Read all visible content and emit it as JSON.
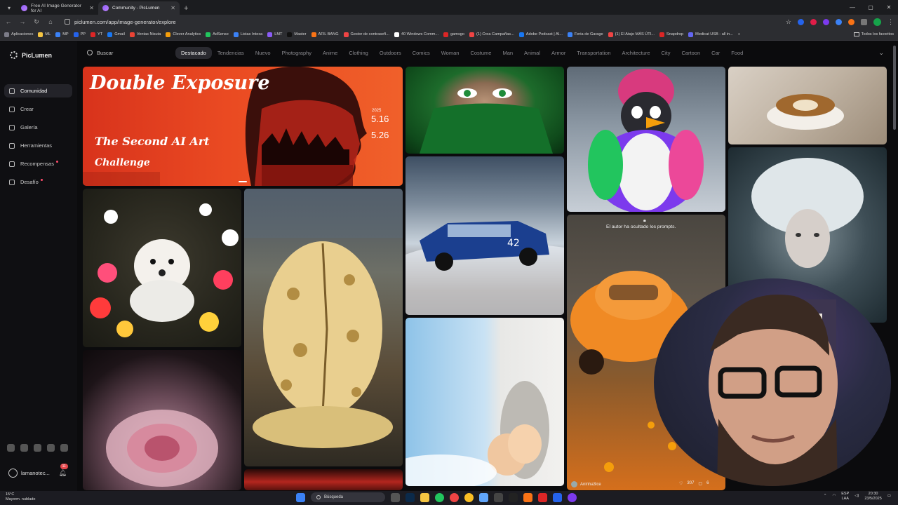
{
  "browser": {
    "tabs": [
      {
        "title": "Free AI Image Generator for AI",
        "active": false
      },
      {
        "title": "Community - PicLumen",
        "active": true
      }
    ],
    "url": "piclumen.com/app/image-generator/explore",
    "bookmarks": [
      "Aplicaciones",
      "ML",
      "MP",
      "PP",
      "YT",
      "Gmail",
      "Ventas Nisuta",
      "Clever Analytics",
      "AdSense",
      "Listas Intexa",
      "LMT",
      "Master",
      "AFIL BANG",
      "Gestor de contraseñ...",
      "40 Windows Comm...",
      "gamsgo",
      "(1) Crea Campañas...",
      "Adobe Podcast | AI...",
      "Feria de Garage",
      "(1) El Atajo MÁS ÚTI...",
      "Snapdrop",
      "Medicat USB - all in..."
    ],
    "bookmarks_all": "Todos los favoritos"
  },
  "app": {
    "logo": "PicLumen",
    "sidebar": [
      {
        "label": "Comunidad",
        "active": true,
        "dot": false
      },
      {
        "label": "Crear",
        "active": false,
        "dot": false
      },
      {
        "label": "Galería",
        "active": false,
        "dot": false
      },
      {
        "label": "Herramientas",
        "active": false,
        "dot": false
      },
      {
        "label": "Recompensas",
        "active": false,
        "dot": true
      },
      {
        "label": "Desafío",
        "active": false,
        "dot": true
      }
    ],
    "user": {
      "name": "lamanotec...",
      "notifications": "11"
    },
    "search_placeholder": "Buscar",
    "categories": [
      "Destacado",
      "Tendencias",
      "Nuevo",
      "Photography",
      "Anime",
      "Clothing",
      "Outdoors",
      "Comics",
      "Woman",
      "Costume",
      "Man",
      "Animal",
      "Armor",
      "Transportation",
      "Architecture",
      "City",
      "Cartoon",
      "Car",
      "Food"
    ],
    "active_category": "Destacado"
  },
  "banner": {
    "title": "Double Exposure",
    "subtitle": "The Second AI Art",
    "subtitle2": "Challenge",
    "year": "2025",
    "date_start": "5.16",
    "date_end": "5.26"
  },
  "hidden_prompt_note": "El autor ha ocultado los prompts.",
  "card_meta": {
    "author": "Aninha3lce",
    "likes": "307",
    "comments": "6"
  },
  "taskbar": {
    "weather_temp": "15°C",
    "weather_desc": "Mayorm. nublado",
    "search": "Búsqueda",
    "lang": "ESP",
    "lang2": "LAA",
    "time": "20:30",
    "date": "23/5/2025"
  },
  "colors": {
    "accent": "#8b5cf6",
    "banner_red": "#e1361f",
    "sidebar_active": "#232329"
  }
}
